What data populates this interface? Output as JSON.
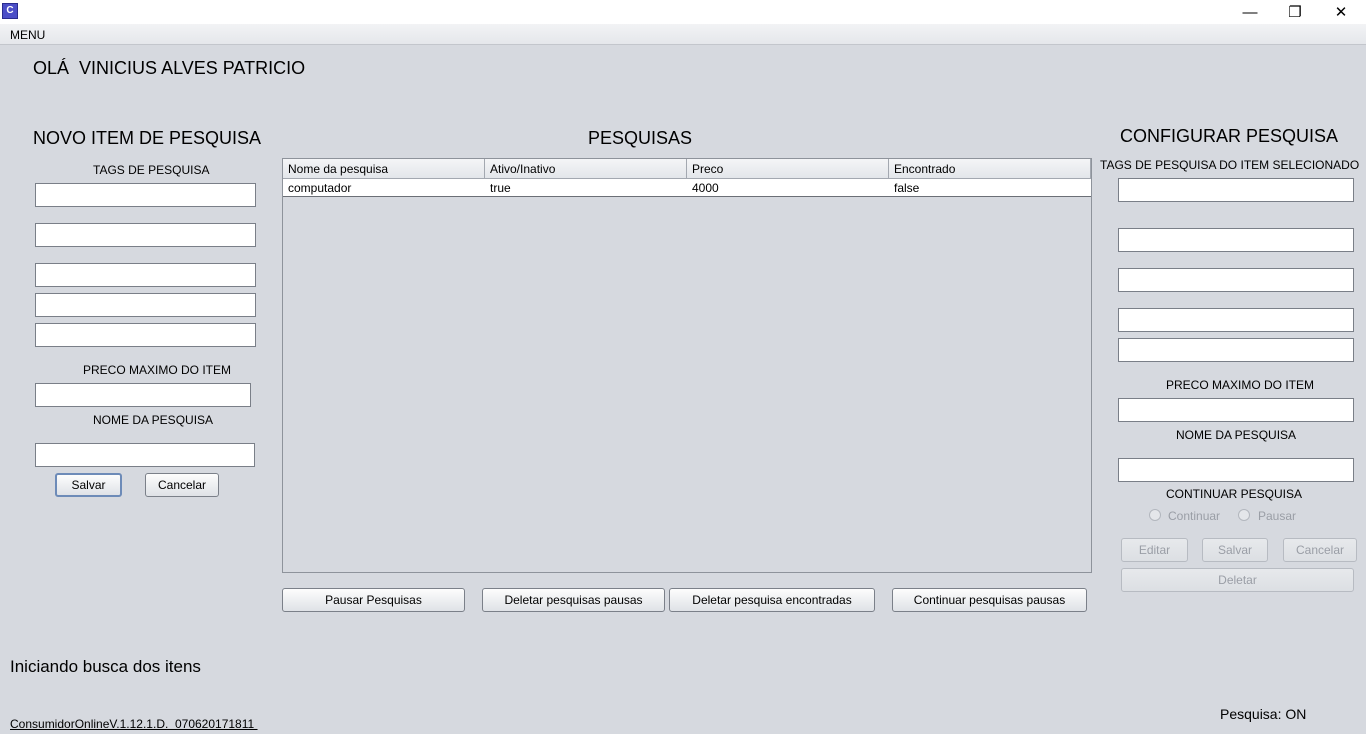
{
  "window": {
    "app_icon_text": "C",
    "minimize_glyph": "—",
    "restore_glyph": "❐",
    "close_glyph": "✕"
  },
  "menu": {
    "label": "MENU"
  },
  "greeting": {
    "prefix": "OLÁ",
    "user": "VINICIUS ALVES PATRICIO"
  },
  "left_panel": {
    "title": "NOVO ITEM DE PESQUISA",
    "tags_label": "TAGS DE PESQUISA",
    "max_price_label": "PRECO MAXIMO DO ITEM",
    "search_name_label": "NOME DA PESQUISA",
    "save_button": "Salvar",
    "cancel_button": "Cancelar"
  },
  "center_panel": {
    "title": "PESQUISAS",
    "columns": [
      "Nome da pesquisa",
      "Ativo/Inativo",
      "Preco",
      "Encontrado"
    ],
    "rows": [
      [
        "computador",
        "true",
        "4000",
        "false"
      ]
    ],
    "buttons": {
      "pause": "Pausar Pesquisas",
      "delete_paused": "Deletar pesquisas pausas",
      "delete_found": "Deletar pesquisa encontradas",
      "continue_paused": "Continuar pesquisas pausas"
    }
  },
  "right_panel": {
    "title": "CONFIGURAR PESQUISA",
    "tags_label": "TAGS DE PESQUISA DO ITEM SELECIONADO",
    "max_price_label": "PRECO MAXIMO DO ITEM",
    "search_name_label": "NOME DA PESQUISA",
    "continue_label": "CONTINUAR PESQUISA",
    "radio_continue": "Continuar",
    "radio_pause": "Pausar",
    "edit_button": "Editar",
    "save_button": "Salvar",
    "cancel_button": "Cancelar",
    "delete_button": "Deletar"
  },
  "status": {
    "message": "Iniciando busca dos itens",
    "version": "ConsumidorOnlineV.1.12.1.D.  070620171811 ",
    "search_state": "Pesquisa: ON"
  }
}
